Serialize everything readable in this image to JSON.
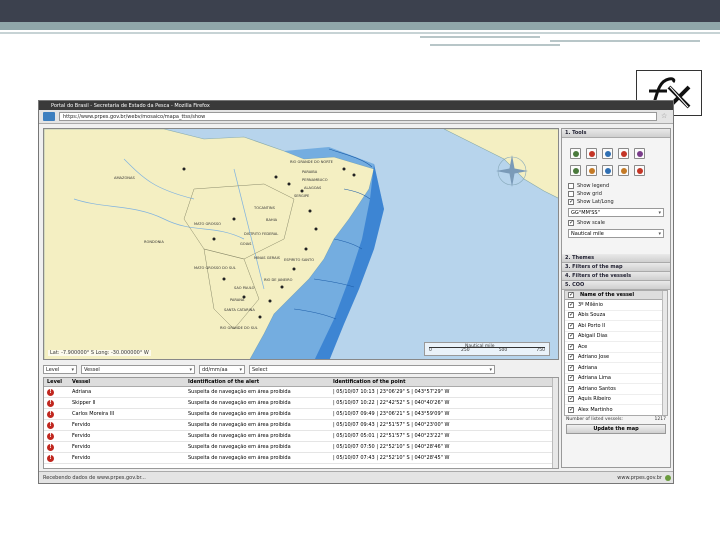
{
  "window": {
    "title": "Portal do Brasil - Secretaria de Estado da Pesca - Mozilla Firefox",
    "url": "https://www.prpes.gov.br/webv/mosaico/mapa_ttss/show"
  },
  "map": {
    "coords_readout": "Lat: -7.900000° S    Long: -30.000000° W",
    "scale_label": "Nautical mile",
    "scale_ticks": [
      "0",
      "250",
      "500",
      "750"
    ],
    "land_color": "#f4efc2",
    "ocean_color": "#b7d4ec",
    "labels": [
      "RIO GRANDE DO NORTE",
      "PARAIBA",
      "PERNAMBUCO",
      "ALAGOAS",
      "SERGIPE",
      "BAHIA",
      "ESPIRITO SANTO",
      "RIO DE JANEIRO",
      "SAO PAULO",
      "PARANA",
      "SANTA CATARINA",
      "RIO GRANDE DO SUL",
      "MATO GROSSO DO SUL",
      "GOIAS",
      "MINAS GERAIS",
      "MATO GROSSO",
      "AMAZONAS",
      "RONDONIA",
      "TOCANTINS",
      "DISTRITO FEDERAL"
    ]
  },
  "filters": {
    "level": "Level",
    "vessel": "Vessel",
    "date": "dd/mm/aa",
    "select": "Select"
  },
  "table": {
    "headers": [
      "Level",
      "Vessel",
      "Identification of the alert",
      "Identification of the point"
    ],
    "rows": [
      {
        "vessel": "Adriana",
        "alert": "Suspeita de navegação em área proibida",
        "point": "| 05/10/07 10:13 | 23°06'29\" S | 043°57'29\" W"
      },
      {
        "vessel": "Skipper II",
        "alert": "Suspeita de navegação em área proibida",
        "point": "| 05/10/07 10:22 | 22°42'52\" S | 040°40'26\" W"
      },
      {
        "vessel": "Carlos Moreira III",
        "alert": "Suspeita de navegação em área proibida",
        "point": "| 05/10/07 09:49 | 23°06'21\" S | 043°59'09\" W"
      },
      {
        "vessel": "Fervido",
        "alert": "Suspeita de navegação em área proibida",
        "point": "| 05/10/07 09:43 | 22°51'57\" S | 040°23'00\" W"
      },
      {
        "vessel": "Fervido",
        "alert": "Suspeita de navegação em área proibida",
        "point": "| 05/10/07 05:01 | 22°51'57\" S | 040°23'22\" W"
      },
      {
        "vessel": "Fervido",
        "alert": "Suspeita de navegação em área proibida",
        "point": "| 05/10/07 07:50 | 22°52'10\" S | 040°28'46\" W"
      },
      {
        "vessel": "Fervido",
        "alert": "Suspeita de navegação em área proibida",
        "point": "| 05/10/07 07:43 | 22°52'10\" S | 040°28'45\" W"
      }
    ]
  },
  "status": {
    "left": "Recebendo dados de www.prpes.gov.br...",
    "right": "www.prpes.gov.br"
  },
  "panel": {
    "section1": "1. Tools",
    "tool_colors": [
      "#4a7a3c",
      "#c43526",
      "#2f6fb3",
      "#c43526",
      "#7a3c8a",
      "#4a7a3c",
      "#c47a26",
      "#2f6fb3",
      "#c47a26",
      "#c43526"
    ],
    "options": [
      {
        "label": "Show legend",
        "on": false
      },
      {
        "label": "Show grid",
        "on": false
      },
      {
        "label": "Show Lat/Long",
        "on": true
      }
    ],
    "coord_format": "GG°MM'SS\"",
    "show_scale": "Show scale",
    "scale_unit": "Nautical mile",
    "section2": "2. Themes",
    "section3": "3. Filters of the map",
    "section4": "4. Filters of the vessels",
    "section5": "5. COO",
    "vessel_list_header": "Name of the vessel",
    "vessels": [
      "3º Milênio",
      "Abis Souza",
      "Abi Porto II",
      "Abigail Dias",
      "Ace",
      "Adriano Jose",
      "Adriana",
      "Adriana Lima",
      "Adriano Santos",
      "Aquis Ribeiro",
      "Alex Martinho"
    ],
    "count_label": "Number of listed vessels:",
    "count_value": "1217",
    "update_button": "Update the map"
  }
}
